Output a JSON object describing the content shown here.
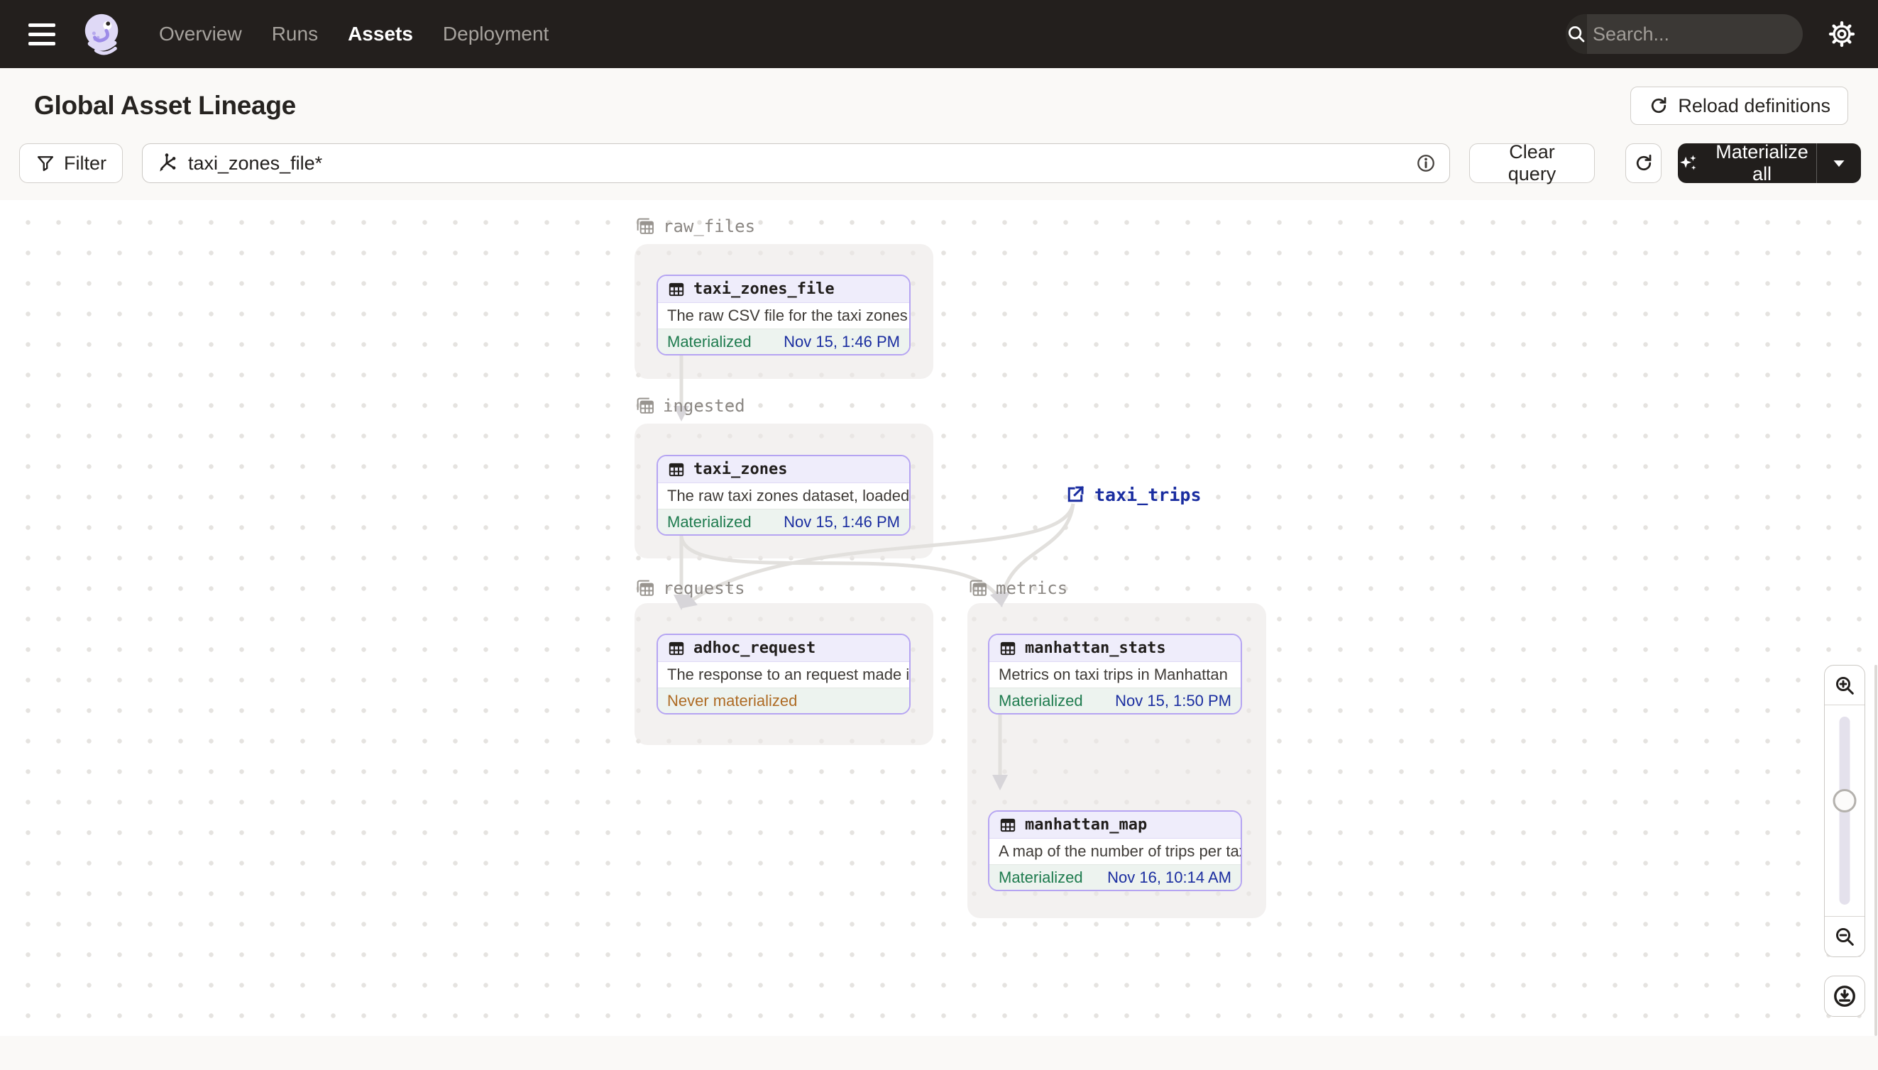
{
  "nav": {
    "menu_items": [
      {
        "label": "Overview",
        "active": false
      },
      {
        "label": "Runs",
        "active": false
      },
      {
        "label": "Assets",
        "active": true
      },
      {
        "label": "Deployment",
        "active": false
      }
    ],
    "search": {
      "placeholder": "Search...",
      "shortcut": "/"
    }
  },
  "header": {
    "title": "Global Asset Lineage",
    "reload_button": "Reload definitions"
  },
  "toolbar": {
    "filter_button": "Filter",
    "query_value": "taxi_zones_file*",
    "clear_button": "Clear query",
    "materialize_button": "Materialize all"
  },
  "graph": {
    "groups": [
      {
        "name": "raw_files"
      },
      {
        "name": "ingested"
      },
      {
        "name": "requests"
      },
      {
        "name": "metrics"
      }
    ],
    "assets": [
      {
        "name": "taxi_zones_file",
        "group": "raw_files",
        "description": "The raw CSV file for the taxi zones dat...",
        "status": "Materialized",
        "timestamp": "Nov 15, 1:46 PM"
      },
      {
        "name": "taxi_zones",
        "group": "ingested",
        "description": "The raw taxi zones dataset, loaded int...",
        "status": "Materialized",
        "timestamp": "Nov 15, 1:46 PM"
      },
      {
        "name": "adhoc_request",
        "group": "requests",
        "description": "The response to an request made in th...",
        "status": "Never materialized",
        "timestamp": ""
      },
      {
        "name": "manhattan_stats",
        "group": "metrics",
        "description": "Metrics on taxi trips in Manhattan",
        "status": "Materialized",
        "timestamp": "Nov 15, 1:50 PM"
      },
      {
        "name": "manhattan_map",
        "group": "metrics",
        "description": "A map of the number of trips per taxi z...",
        "status": "Materialized",
        "timestamp": "Nov 16, 10:14 AM"
      }
    ],
    "external_assets": [
      {
        "name": "taxi_trips"
      }
    ]
  },
  "icons": [
    "menu-icon",
    "dagster-logo",
    "search-icon",
    "slash-shortcut",
    "gear-icon",
    "reload-icon",
    "filter-funnel-icon",
    "asset-graph-query-icon",
    "info-icon",
    "refresh-icon",
    "sparkles-icon",
    "caret-down-icon",
    "table-icon",
    "group-tables-icon",
    "external-link-icon",
    "zoom-in-icon",
    "zoom-out-icon",
    "download-icon"
  ],
  "colors": {
    "nav_background": "#231F1D",
    "page_background": "#FAF9F7",
    "canvas_background": "#FFFFFF",
    "asset_border": "#B5A4F2",
    "asset_header_background": "#EFEDFB",
    "status_materialized": "#1E7B4E",
    "status_never_materialized": "#AE6B24",
    "timestamp": "#1A2DA0",
    "external_asset": "#1A2DA0",
    "group_label": "#8B8783",
    "edge": "#E2E0DD"
  }
}
